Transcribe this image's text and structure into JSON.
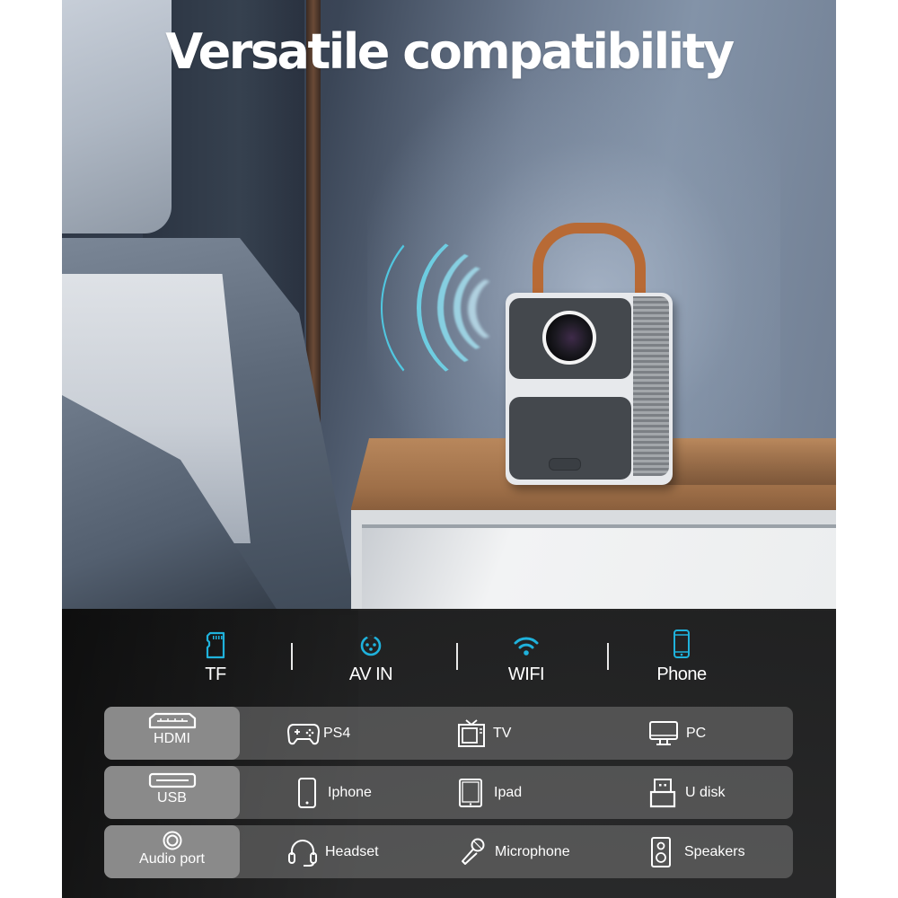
{
  "title": "Versatile compatibility",
  "colors": {
    "accent_cyan": "#1fb2dc",
    "panel_bg": "#262626",
    "label_box": "#8a8a8a",
    "row_bg": "#6e6e6e",
    "text": "#ffffff"
  },
  "scene": {
    "product": "portable projector with leather strap",
    "wireless_signal_icon": "wifi-waves"
  },
  "features": [
    {
      "label": "TF",
      "icon": "sd-card-icon"
    },
    {
      "label": "AV IN",
      "icon": "av-connector-icon"
    },
    {
      "label": "WIFI",
      "icon": "wifi-icon"
    },
    {
      "label": "Phone",
      "icon": "smartphone-icon"
    }
  ],
  "compatibility": [
    {
      "port": {
        "label": "HDMI",
        "icon": "hdmi-port-icon"
      },
      "devices": [
        {
          "label": "PS4",
          "icon": "gamepad-icon"
        },
        {
          "label": "TV",
          "icon": "tv-icon"
        },
        {
          "label": "PC",
          "icon": "monitor-icon"
        }
      ]
    },
    {
      "port": {
        "label": "USB",
        "icon": "usb-port-icon"
      },
      "devices": [
        {
          "label": "Iphone",
          "icon": "phone-icon"
        },
        {
          "label": "Ipad",
          "icon": "tablet-icon"
        },
        {
          "label": "U disk",
          "icon": "usb-drive-icon"
        }
      ]
    },
    {
      "port": {
        "label": "Audio port",
        "icon": "audio-jack-icon"
      },
      "devices": [
        {
          "label": "Headset",
          "icon": "headset-icon"
        },
        {
          "label": "Microphone",
          "icon": "microphone-icon"
        },
        {
          "label": "Speakers",
          "icon": "speaker-icon"
        }
      ]
    }
  ]
}
